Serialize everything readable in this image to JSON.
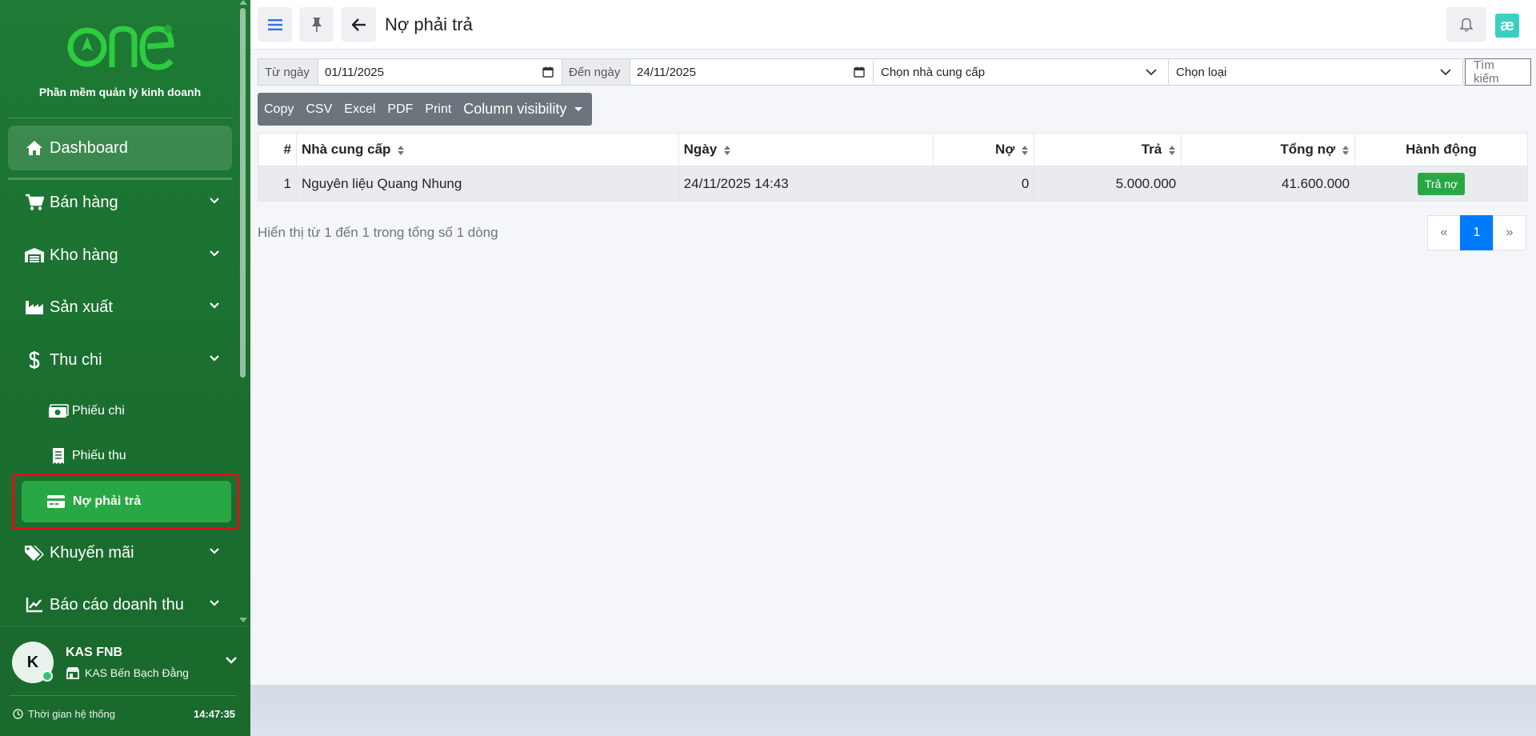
{
  "app": {
    "subtitle": "Phần mềm quản lý kinh doanh"
  },
  "colors": {
    "sidebar": "#1e7a35",
    "active": "#28a745",
    "highlight": "#e0101a",
    "primary": "#007bff",
    "badge": "#38d1c1"
  },
  "sidebar": {
    "dashboard": "Dashboard",
    "items": [
      {
        "label": "Bán hàng",
        "icon": "cart-icon"
      },
      {
        "label": "Kho hàng",
        "icon": "warehouse-icon"
      },
      {
        "label": "Sản xuất",
        "icon": "factory-icon"
      },
      {
        "label": "Thu chi",
        "icon": "dollar-icon"
      }
    ],
    "sub_items": [
      {
        "label": "Phiếu chi",
        "icon": "money-bill-icon"
      },
      {
        "label": "Phiếu thu",
        "icon": "receipt-icon"
      }
    ],
    "active_item": {
      "label": "Nợ phải trả",
      "icon": "credit-card-icon"
    },
    "items_after": [
      {
        "label": "Khuyến mãi",
        "icon": "tags-icon"
      },
      {
        "label": "Báo cáo doanh thu",
        "icon": "chart-line-icon"
      }
    ]
  },
  "user": {
    "initial": "K",
    "name": "KAS FNB",
    "store": "KAS Bến Bạch Đằng",
    "time_label": "Thời gian hệ thống",
    "time": "14:47:35"
  },
  "header": {
    "title": "Nợ phải trả",
    "badge": "æ"
  },
  "filters": {
    "from_label": "Từ ngày",
    "from_value": "01/11/2025",
    "to_label": "Đến ngày",
    "to_value": "24/11/2025",
    "supplier_placeholder": "Chọn nhà cung cấp",
    "type_placeholder": "Chọn loại",
    "search_button": "Tìm kiếm"
  },
  "export_buttons": {
    "copy": "Copy",
    "csv": "CSV",
    "excel": "Excel",
    "pdf": "PDF",
    "print": "Print",
    "column_visibility": "Column visibility"
  },
  "table": {
    "columns": [
      "#",
      "Nhà cung cấp",
      "Ngày",
      "Nợ",
      "Trả",
      "Tổng nợ",
      "Hành động"
    ],
    "rows": [
      {
        "index": "1",
        "supplier": "Nguyên liệu Quang Nhung",
        "date": "24/11/2025 14:43",
        "debt": "0",
        "paid": "5.000.000",
        "total": "41.600.000",
        "action": "Trả nợ"
      }
    ],
    "info": "Hiển thị từ 1 đến 1 trong tổng số 1 dòng"
  },
  "pagination": {
    "prev": "«",
    "current": "1",
    "next": "»"
  }
}
